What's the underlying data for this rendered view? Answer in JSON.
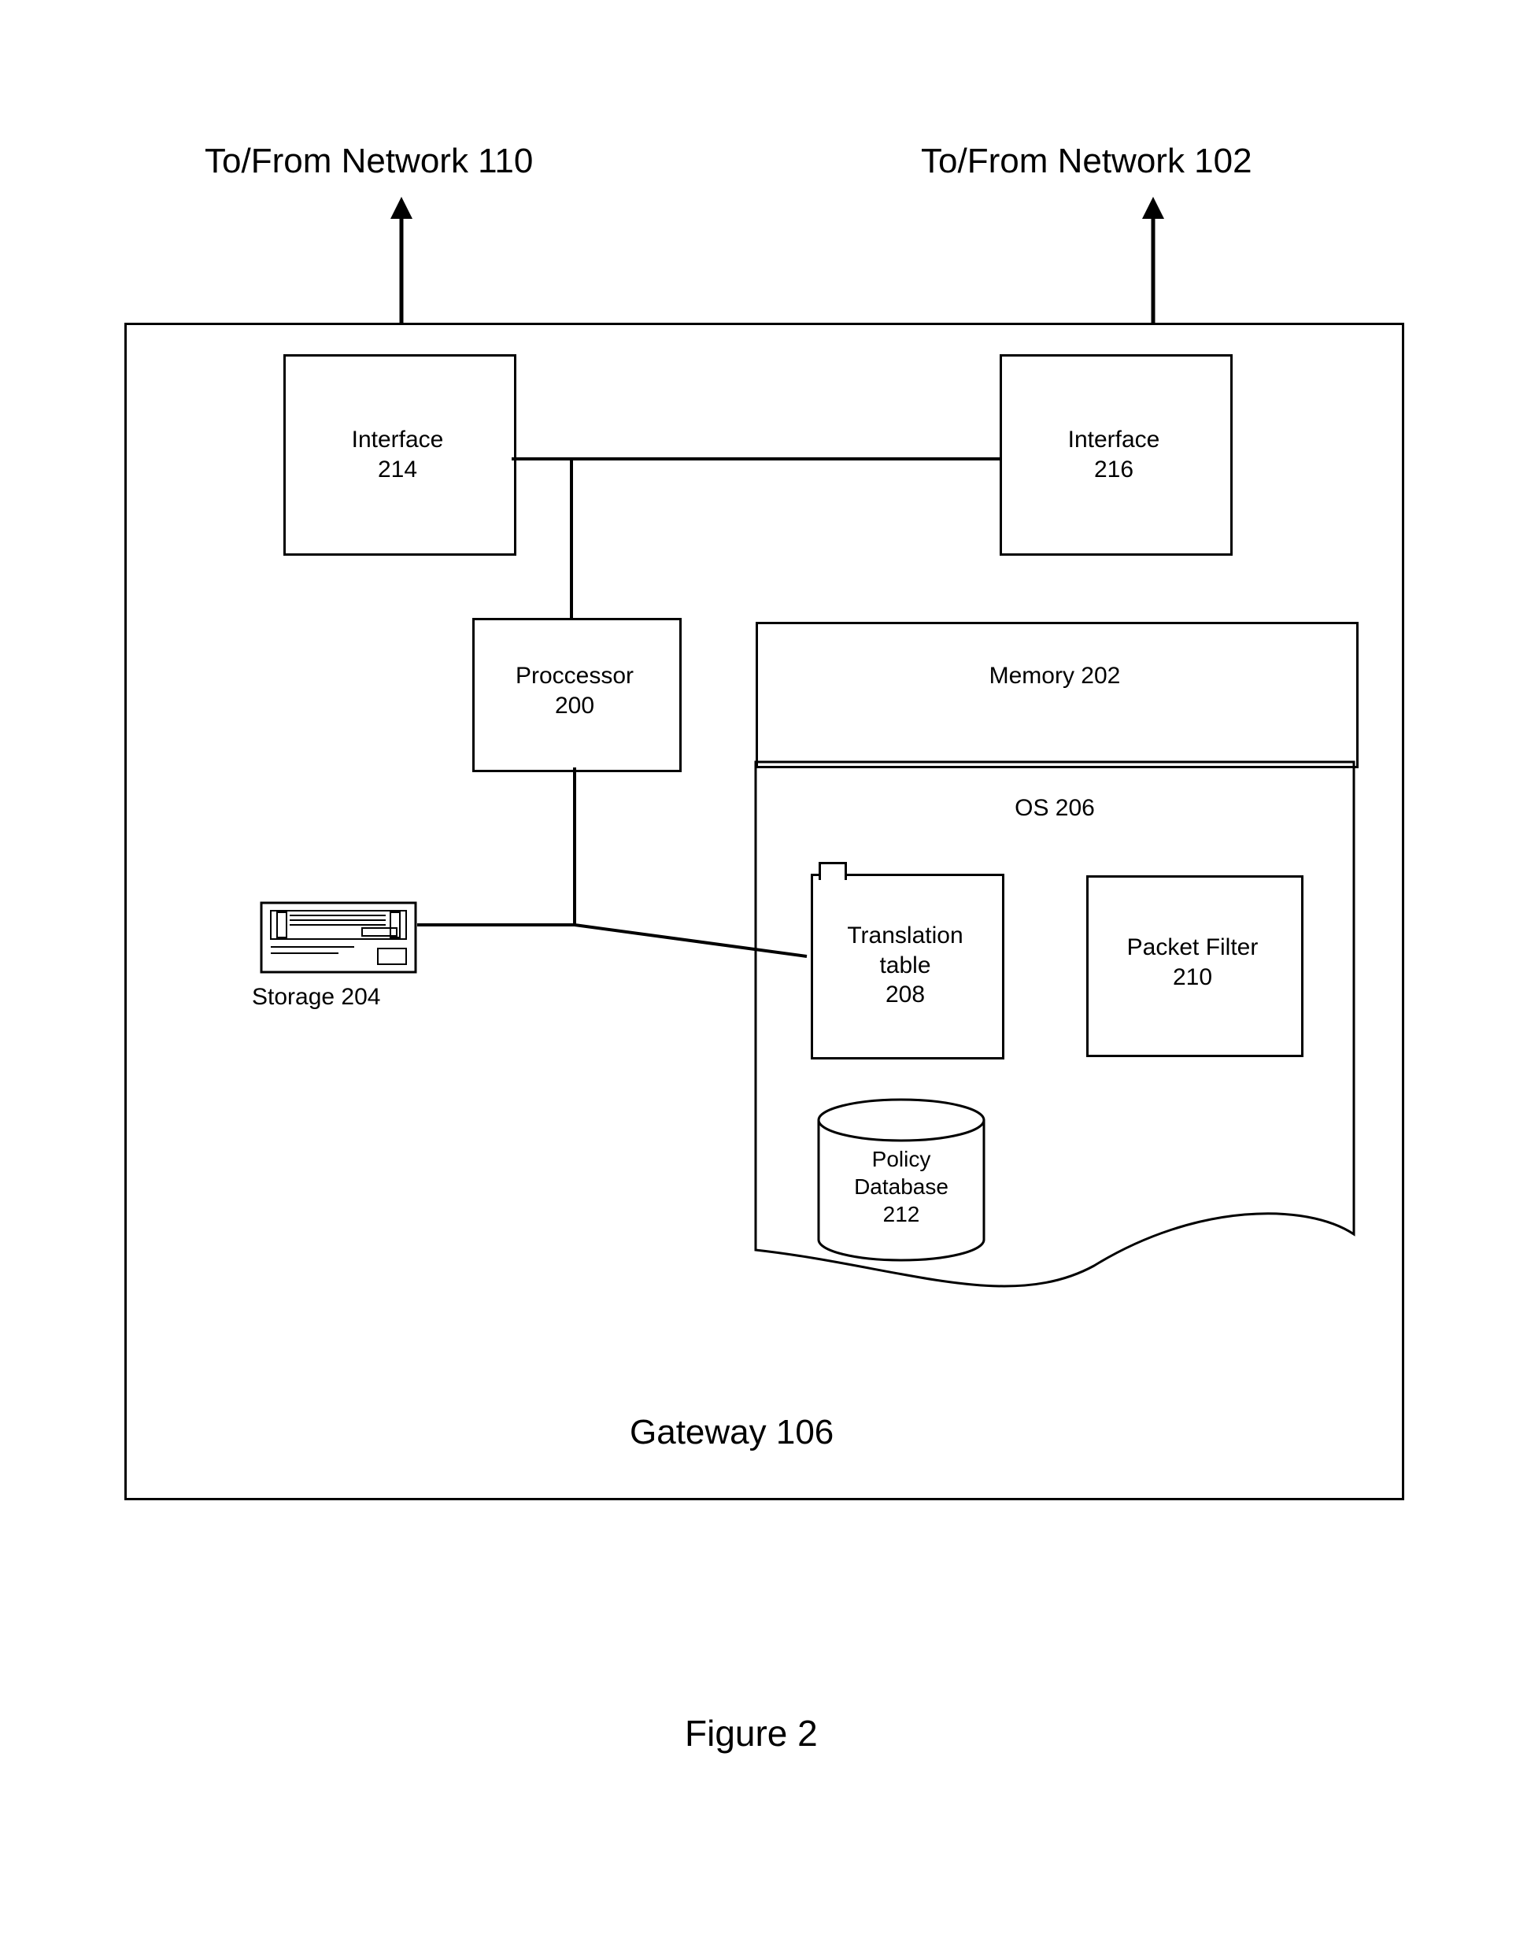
{
  "labels": {
    "net110": "To/From Network 110",
    "net102": "To/From Network 102",
    "figure": "Figure 2",
    "gateway": "Gateway 106"
  },
  "boxes": {
    "iface214": {
      "name": "Interface",
      "id": "214"
    },
    "iface216": {
      "name": "Interface",
      "id": "216"
    },
    "proc": {
      "name": "Proccessor",
      "id": "200"
    },
    "memory": {
      "name": "Memory 202"
    },
    "os": {
      "name": "OS 206"
    },
    "trans": {
      "name": "Translation",
      "sub": "table",
      "id": "208"
    },
    "pfilter": {
      "name": "Packet Filter",
      "id": "210"
    },
    "policy": {
      "name": "Policy",
      "sub": "Database",
      "id": "212"
    },
    "storage": {
      "name": "Storage 204"
    }
  }
}
